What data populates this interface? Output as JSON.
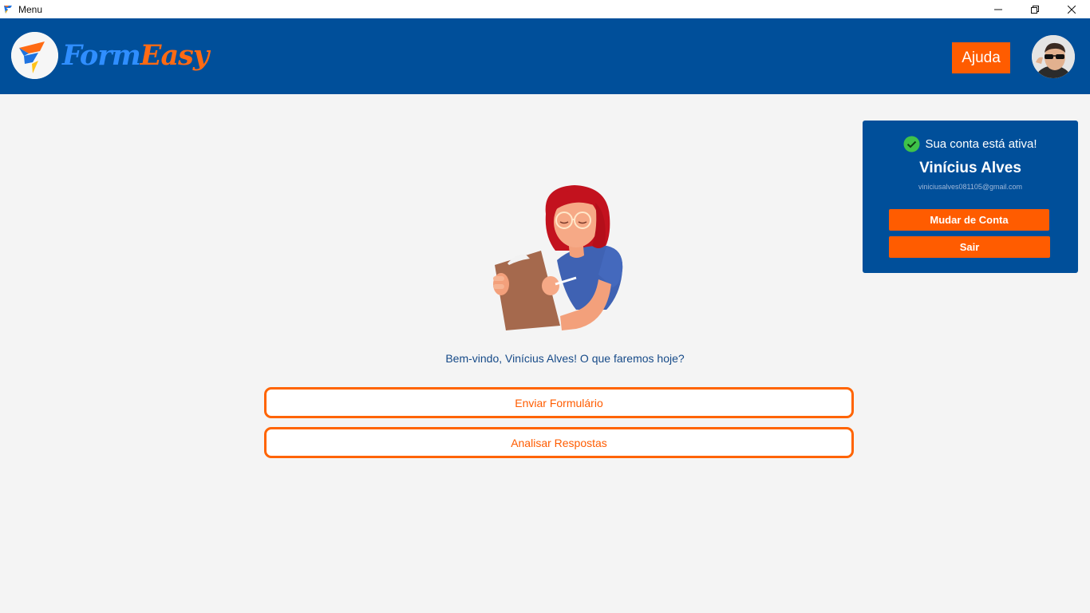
{
  "window": {
    "title": "Menu",
    "controls": [
      "minimize-icon",
      "restore-icon",
      "close-icon"
    ]
  },
  "header": {
    "logo": {
      "part1": "Form",
      "part2": "Easy"
    },
    "help_label": "Ajuda",
    "avatar_icon": "user-avatar"
  },
  "account": {
    "status": "Sua conta está ativa!",
    "status_icon": "check-circle-icon",
    "name": "Vinícius Alves",
    "email": "viniciusalves081105@gmail.com",
    "switch_label": "Mudar de Conta",
    "logout_label": "Sair"
  },
  "main": {
    "illustration": "woman-with-clipboard",
    "welcome": "Bem-vindo, Vinícius Alves! O que faremos hoje?",
    "actions": [
      {
        "label": "Enviar Formulário"
      },
      {
        "label": "Analisar Respostas"
      }
    ]
  },
  "colors": {
    "primary": "#004f9a",
    "accent": "#ff5c00",
    "background": "#f4f4f4",
    "success": "#3fc24a"
  }
}
